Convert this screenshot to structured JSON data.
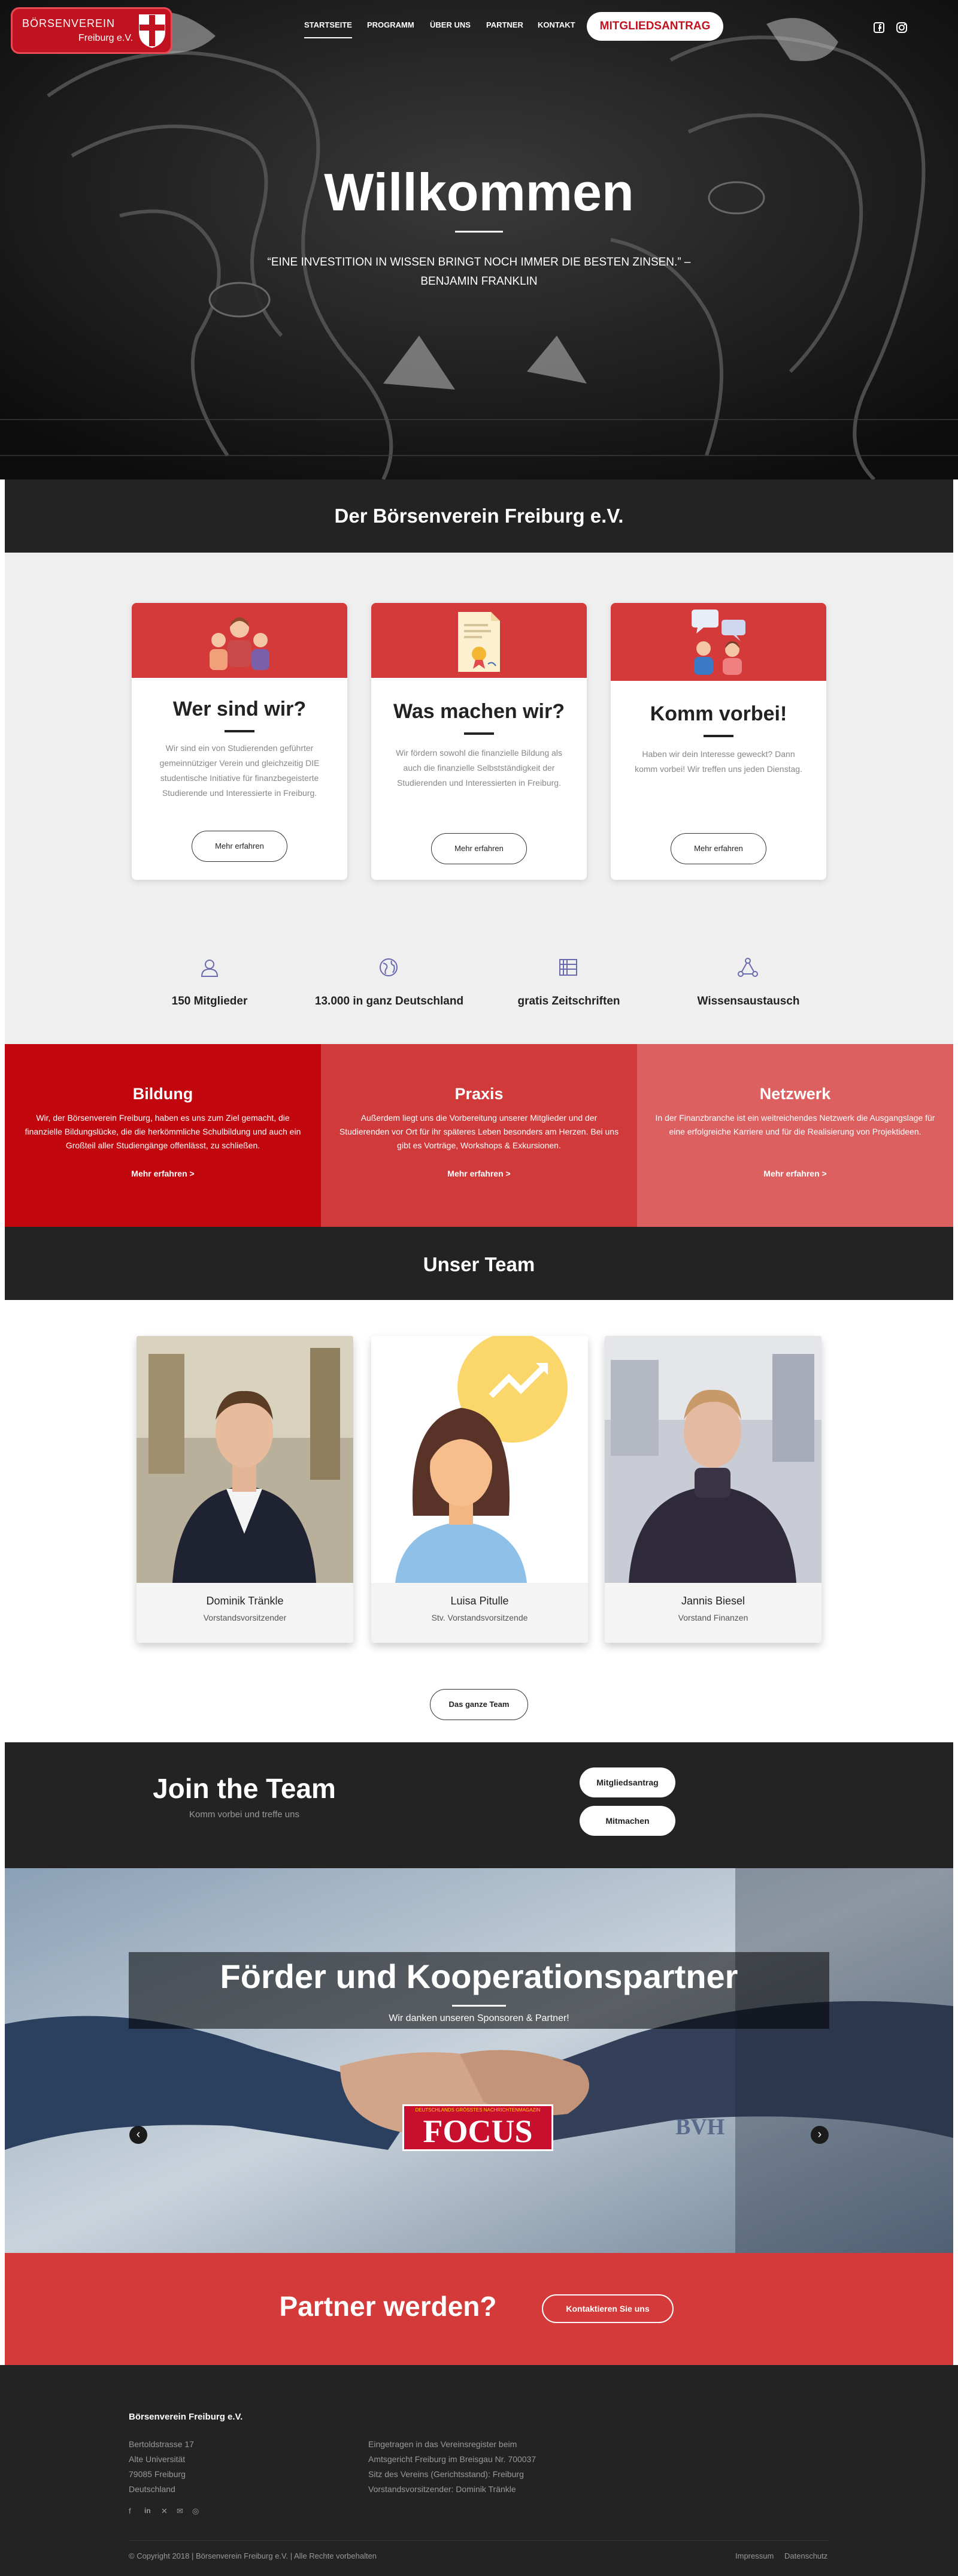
{
  "header": {
    "logo_line1": "BÖRSENVEREIN",
    "logo_line2": "Freiburg e.V.",
    "nav": [
      "Startseite",
      "Programm",
      "Über uns",
      "Partner",
      "Kontakt"
    ],
    "cta": "Mitgliedsantrag",
    "social_icons": [
      "facebook-icon",
      "instagram-icon"
    ]
  },
  "hero": {
    "title": "Willkommen",
    "quote": "“Eine Investition in Wissen bringt noch immer die besten Zinsen.” – Benjamin Franklin"
  },
  "about": {
    "title": "Der Börsenverein Freiburg e.V.",
    "cards": [
      {
        "icon": "group-people-icon",
        "title": "Wer sind wir?",
        "text": "Wir sind ein von Studierenden geführter gemeinnütziger Verein und gleichzeitig DIE studentische Initiative für finanzbegeisterte Studierende und Interessierte in Freiburg.",
        "button": "Mehr erfahren"
      },
      {
        "icon": "certificate-icon",
        "title": "Was machen wir?",
        "text": "Wir fördern sowohl die finanzielle Bildung als auch die finanzielle Selbstständigkeit der Studierenden und Interessierten in Freiburg.",
        "button": "Mehr erfahren"
      },
      {
        "icon": "chat-people-icon",
        "title": "Komm vorbei!",
        "text": "Haben wir dein Interesse geweckt? Dann komm vorbei! Wir treffen uns jeden Dienstag.",
        "button": "Mehr erfahren"
      }
    ],
    "stats": [
      {
        "icon": "member-icon",
        "label": "150 Mitglieder"
      },
      {
        "icon": "globe-icon",
        "label": "13.000 in ganz Deutschland"
      },
      {
        "icon": "magazine-icon",
        "label": "gratis Zeitschriften"
      },
      {
        "icon": "network-icon",
        "label": "Wissensaustausch"
      }
    ]
  },
  "pillars": [
    {
      "title": "Bildung",
      "text": "Wir, der Börsenverein Freiburg, haben es uns zum Ziel gemacht, die finanzielle Bildungslücke, die die herkömmliche Schulbildung und auch ein Großteil aller Studiengänge offenlässt, zu schließen.",
      "link": "Mehr erfahren >",
      "color": "#c1060d"
    },
    {
      "title": "Praxis",
      "text": "Außerdem liegt uns die Vorbereitung unserer Mitglieder und der Studierenden vor Ort für ihr späteres Leben besonders am Herzen. Bei uns gibt es Vorträge, Workshops & Exkursionen.",
      "link": "Mehr erfahren >",
      "color": "#d03a3a"
    },
    {
      "title": "Netzwerk",
      "text": "In der Finanzbranche ist ein weitreichendes Netzwerk die Ausgangslage für eine erfolgreiche Karriere und für die Realisierung von Projektideen.",
      "link": "Mehr erfahren >",
      "color": "#dc6060"
    }
  ],
  "team": {
    "title": "Unser Team",
    "members": [
      {
        "name": "Dominik Tränkle",
        "role": "Vorstandsvorsitzender"
      },
      {
        "name": "Luisa Pitulle",
        "role": "Stv. Vorstandsvorsitzende"
      },
      {
        "name": "Jannis Biesel",
        "role": "Vorstand Finanzen"
      }
    ],
    "button": "Das ganze Team"
  },
  "join": {
    "title": "Join the Team",
    "subtitle": "Komm vorbei und treffe uns",
    "buttons": [
      "Mitgliedsantrag",
      "Mitmachen"
    ]
  },
  "partners": {
    "title": "Förder und Kooperationspartner",
    "subtitle": "Wir danken unseren Sponsoren & Partner!",
    "logos": [
      "FOCUS",
      "BVH"
    ],
    "focus_tagline": "DEUTSCHLANDS GRÖSSTES NACHRICHTENMAGAZIN"
  },
  "partner_cta": {
    "title": "Partner werden?",
    "button": "Kontaktieren Sie uns"
  },
  "footer": {
    "org": "Börsenverein Freiburg e.V.",
    "address": [
      "Bertoldstrasse 17",
      "Alte Universität",
      "79085 Freiburg",
      "Deutschland"
    ],
    "legal": [
      "Eingetragen in das Vereinsregister beim",
      "Amtsgericht Freiburg im Breisgau Nr. 700037",
      "Sitz des Vereins (Gerichtsstand): Freiburg",
      "Vorstandsvorsitzender: Dominik Tränkle"
    ],
    "social_icons": [
      "facebook-icon",
      "linkedin-icon",
      "xing-icon",
      "email-icon",
      "instagram-icon"
    ],
    "copyright": "© Copyright 2018 | Börsenverein Freiburg e.V. | Alle Rechte vorbehalten",
    "links": [
      "Impressum",
      "Datenschutz"
    ]
  }
}
